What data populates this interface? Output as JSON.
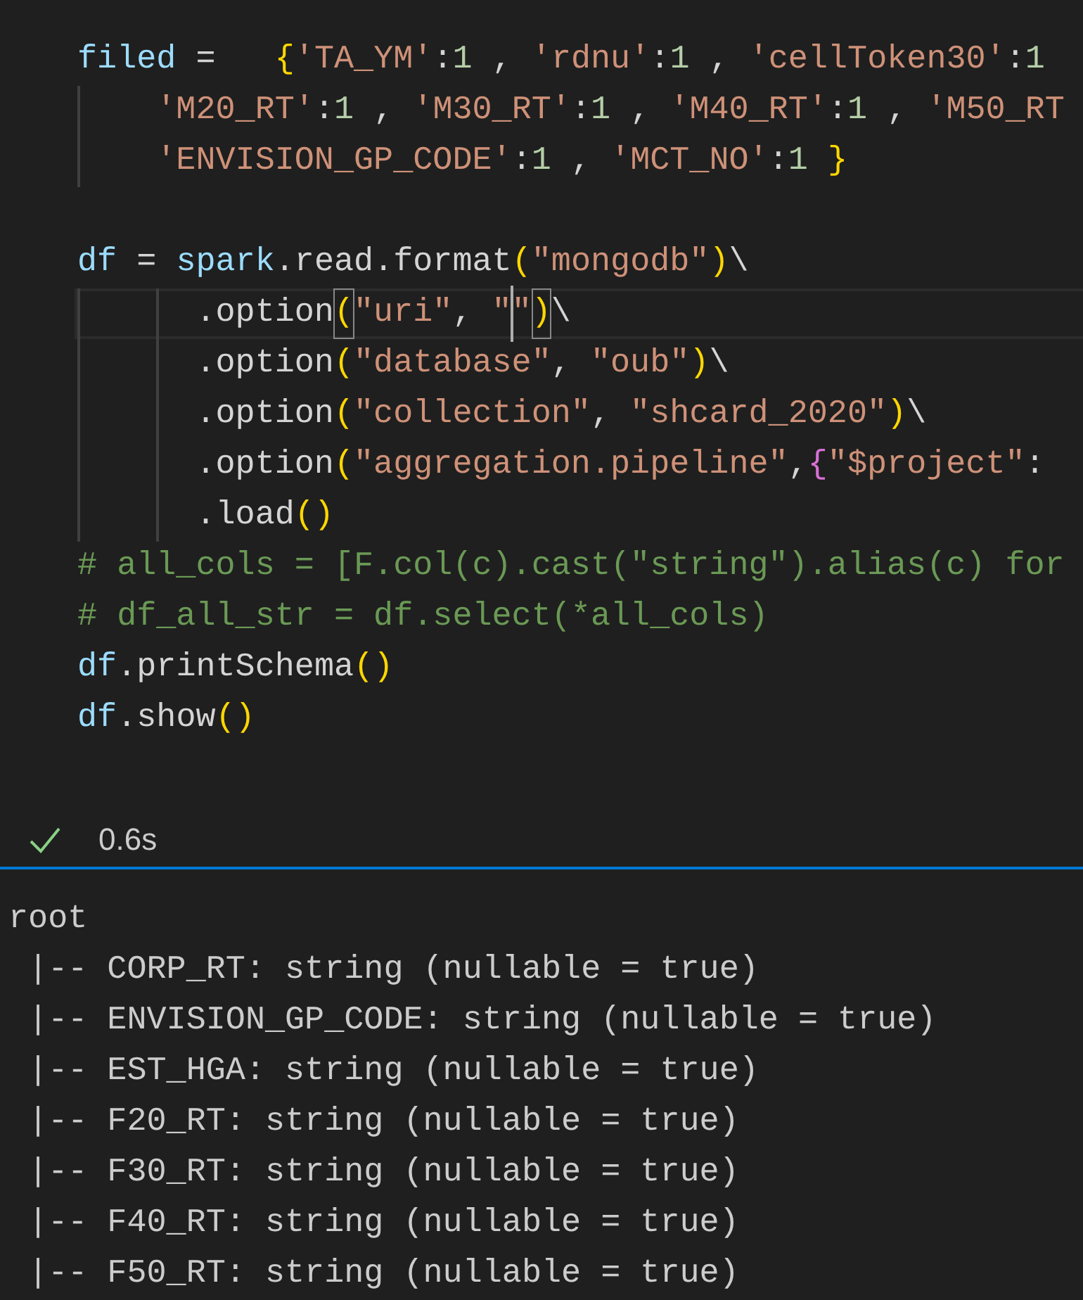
{
  "code_lines": [
    {
      "tokens": [
        {
          "text": "filed",
          "kind": "var"
        },
        {
          "text": " =   ",
          "kind": "plain"
        },
        {
          "text": "{",
          "kind": "bracket1"
        },
        {
          "text": "'TA_YM'",
          "kind": "string"
        },
        {
          "text": ":",
          "kind": "plain"
        },
        {
          "text": "1",
          "kind": "number"
        },
        {
          "text": " , ",
          "kind": "plain"
        },
        {
          "text": "'rdnu'",
          "kind": "string"
        },
        {
          "text": ":",
          "kind": "plain"
        },
        {
          "text": "1",
          "kind": "number"
        },
        {
          "text": " , ",
          "kind": "plain"
        },
        {
          "text": "'cellToken30'",
          "kind": "string"
        },
        {
          "text": ":",
          "kind": "plain"
        },
        {
          "text": "1",
          "kind": "number"
        }
      ]
    },
    {
      "tokens": [
        {
          "text": "    'M20_RT'",
          "kind": "string"
        },
        {
          "text": ":",
          "kind": "plain"
        },
        {
          "text": "1",
          "kind": "number"
        },
        {
          "text": " , ",
          "kind": "plain"
        },
        {
          "text": "'M30_RT'",
          "kind": "string"
        },
        {
          "text": ":",
          "kind": "plain"
        },
        {
          "text": "1",
          "kind": "number"
        },
        {
          "text": " , ",
          "kind": "plain"
        },
        {
          "text": "'M40_RT'",
          "kind": "string"
        },
        {
          "text": ":",
          "kind": "plain"
        },
        {
          "text": "1",
          "kind": "number"
        },
        {
          "text": " , ",
          "kind": "plain"
        },
        {
          "text": "'M50_RT",
          "kind": "string"
        }
      ]
    },
    {
      "tokens": [
        {
          "text": "    'ENVISION_GP_CODE'",
          "kind": "string"
        },
        {
          "text": ":",
          "kind": "plain"
        },
        {
          "text": "1",
          "kind": "number"
        },
        {
          "text": " , ",
          "kind": "plain"
        },
        {
          "text": "'MCT_NO'",
          "kind": "string"
        },
        {
          "text": ":",
          "kind": "plain"
        },
        {
          "text": "1",
          "kind": "number"
        },
        {
          "text": " }",
          "kind": "bracket1"
        }
      ]
    },
    {
      "blank_before": true,
      "tokens": [
        {
          "text": "df",
          "kind": "var"
        },
        {
          "text": " = ",
          "kind": "plain"
        },
        {
          "text": "spark",
          "kind": "var"
        },
        {
          "text": ".read.format",
          "kind": "plain"
        },
        {
          "text": "(",
          "kind": "bracket1"
        },
        {
          "text": "\"mongodb\"",
          "kind": "string"
        },
        {
          "text": ")",
          "kind": "bracket1"
        },
        {
          "text": "\\",
          "kind": "plain"
        }
      ]
    },
    {
      "current": true,
      "tokens": [
        {
          "text": "      .option",
          "kind": "plain"
        },
        {
          "text": "(",
          "kind": "bracket1",
          "matched": true
        },
        {
          "text": "\"uri\"",
          "kind": "string"
        },
        {
          "text": ", ",
          "kind": "plain"
        },
        {
          "text": "\"",
          "kind": "string"
        },
        {
          "text": "\"",
          "kind": "string",
          "caret_before": true
        },
        {
          "text": ")",
          "kind": "bracket1",
          "matched": true
        },
        {
          "text": "\\",
          "kind": "plain"
        }
      ]
    },
    {
      "tokens": [
        {
          "text": "      .option",
          "kind": "plain"
        },
        {
          "text": "(",
          "kind": "bracket1"
        },
        {
          "text": "\"database\"",
          "kind": "string"
        },
        {
          "text": ", ",
          "kind": "plain"
        },
        {
          "text": "\"oub\"",
          "kind": "string"
        },
        {
          "text": ")",
          "kind": "bracket1"
        },
        {
          "text": "\\",
          "kind": "plain"
        }
      ]
    },
    {
      "tokens": [
        {
          "text": "      .option",
          "kind": "plain"
        },
        {
          "text": "(",
          "kind": "bracket1"
        },
        {
          "text": "\"collection\"",
          "kind": "string"
        },
        {
          "text": ", ",
          "kind": "plain"
        },
        {
          "text": "\"shcard_2020\"",
          "kind": "string"
        },
        {
          "text": ")",
          "kind": "bracket1"
        },
        {
          "text": "\\",
          "kind": "plain"
        }
      ]
    },
    {
      "tokens": [
        {
          "text": "      .option",
          "kind": "plain"
        },
        {
          "text": "(",
          "kind": "bracket1"
        },
        {
          "text": "\"aggregation.pipeline\"",
          "kind": "string"
        },
        {
          "text": ",",
          "kind": "plain"
        },
        {
          "text": "{",
          "kind": "bracket2"
        },
        {
          "text": "\"$project\"",
          "kind": "string"
        },
        {
          "text": ":",
          "kind": "plain"
        }
      ]
    },
    {
      "tokens": [
        {
          "text": "      .load",
          "kind": "plain"
        },
        {
          "text": "()",
          "kind": "bracket1"
        }
      ]
    },
    {
      "tokens": [
        {
          "text": "# all_cols = [F.col(c).cast(\"string\").alias(c) for",
          "kind": "comment"
        }
      ]
    },
    {
      "tokens": [
        {
          "text": "# df_all_str = df.select(*all_cols)",
          "kind": "comment"
        }
      ]
    },
    {
      "tokens": [
        {
          "text": "df",
          "kind": "var"
        },
        {
          "text": ".printSchema",
          "kind": "plain"
        },
        {
          "text": "()",
          "kind": "bracket1"
        }
      ]
    },
    {
      "tokens": [
        {
          "text": "df",
          "kind": "var"
        },
        {
          "text": ".show",
          "kind": "plain"
        },
        {
          "text": "()",
          "kind": "bracket1"
        }
      ]
    }
  ],
  "execution": {
    "success": true,
    "duration": "0.6s"
  },
  "output_lines": [
    "root",
    " |-- CORP_RT: string (nullable = true)",
    " |-- ENVISION_GP_CODE: string (nullable = true)",
    " |-- EST_HGA: string (nullable = true)",
    " |-- F20_RT: string (nullable = true)",
    " |-- F30_RT: string (nullable = true)",
    " |-- F40_RT: string (nullable = true)",
    " |-- F50_RT: string (nullable = true)"
  ]
}
